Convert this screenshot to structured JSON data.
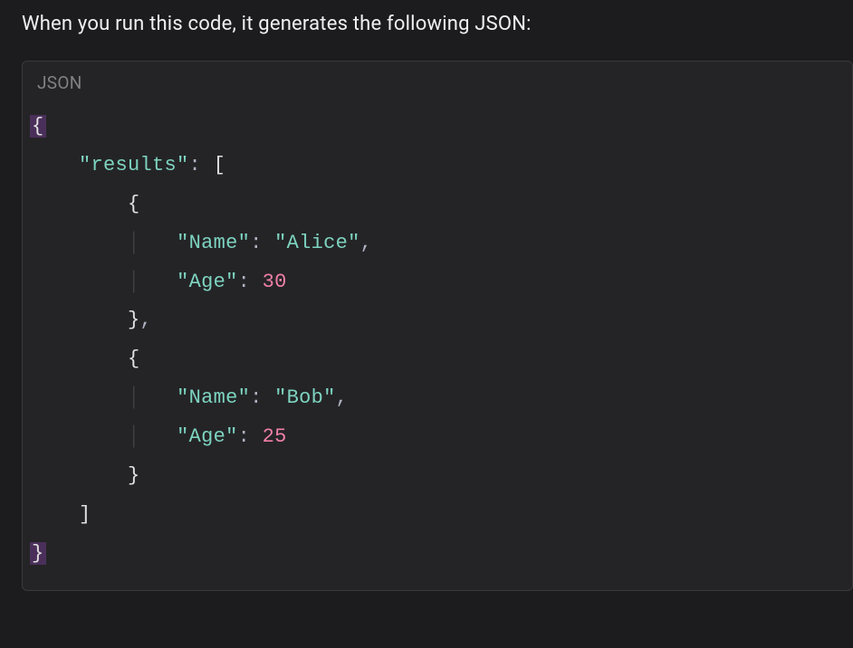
{
  "intro_text": "When you run this code, it generates the following JSON:",
  "code_block": {
    "language_label": "JSON",
    "content": {
      "root_open": "{",
      "root_close": "}",
      "array_key": "\"results\"",
      "array_open": "[",
      "array_close": "]",
      "entries": [
        {
          "open": "{",
          "close": "}",
          "fields": [
            {
              "key": "\"Name\"",
              "value": "\"Alice\"",
              "type": "string",
              "trailing_comma": true
            },
            {
              "key": "\"Age\"",
              "value": "30",
              "type": "number",
              "trailing_comma": false
            }
          ],
          "trailing_comma": true
        },
        {
          "open": "{",
          "close": "}",
          "fields": [
            {
              "key": "\"Name\"",
              "value": "\"Bob\"",
              "type": "string",
              "trailing_comma": true
            },
            {
              "key": "\"Age\"",
              "value": "25",
              "type": "number",
              "trailing_comma": false
            }
          ],
          "trailing_comma": false
        }
      ]
    }
  }
}
